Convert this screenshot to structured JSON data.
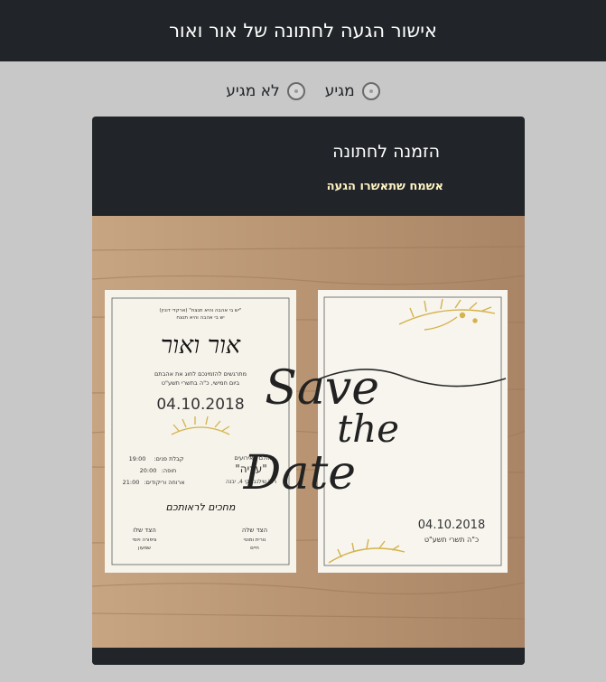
{
  "header": {
    "title": "אישור הגעה לחתונה של אור ואור"
  },
  "rsvp": {
    "options": [
      {
        "label": "מגיע"
      },
      {
        "label": "לא מגיע"
      }
    ]
  },
  "card": {
    "title": "הזמנה לחתונה",
    "subtitle": "אשמח שתאשרו הגעה",
    "invitation": {
      "verse_line1": "\"יש בי אהבה והיא תנצח\" (ארקדי דוכין)",
      "verse_line2": "יש בי אהבה והיא תנצח",
      "names": "אור ואור",
      "intro_line1": "מתרגשים להזמינכם לחוג את אהבתם",
      "intro_line2": "ביום חמישי, כ\"ה בתשרי תשע\"ט",
      "date": "04.10.2018",
      "venue_label": "באולם האירועים",
      "venue_name": "\"עדיה\"",
      "venue_address": "רח' שילנבסקי 4, יבנה",
      "schedule": [
        {
          "label": "קבלת פנים:",
          "time": "19:00"
        },
        {
          "label": "חופה:",
          "time": "20:00"
        },
        {
          "label": "ארוחה וריקודים:",
          "time": "21:00"
        }
      ],
      "closing": "מחכים לראותכם",
      "bride_side_title": "הצד שלה",
      "bride_side_line1": "נורית ומוטי",
      "bride_side_line2": "חיים",
      "groom_side_title": "הצד שלו",
      "groom_side_line1": "ציפורה ויוסי",
      "groom_side_line2": "שמעון"
    },
    "save_the_date": {
      "line1": "Save",
      "line2": "the",
      "line3": "Date",
      "date": "04.10.2018",
      "hebrew_date": "כ\"ה תשרי תשע\"ט"
    }
  },
  "colors": {
    "topbar": "#212529",
    "page_bg": "#c8c8c8",
    "subtitle": "#fff3c4",
    "gold": "#d4b24c",
    "wood": "#b89472"
  }
}
